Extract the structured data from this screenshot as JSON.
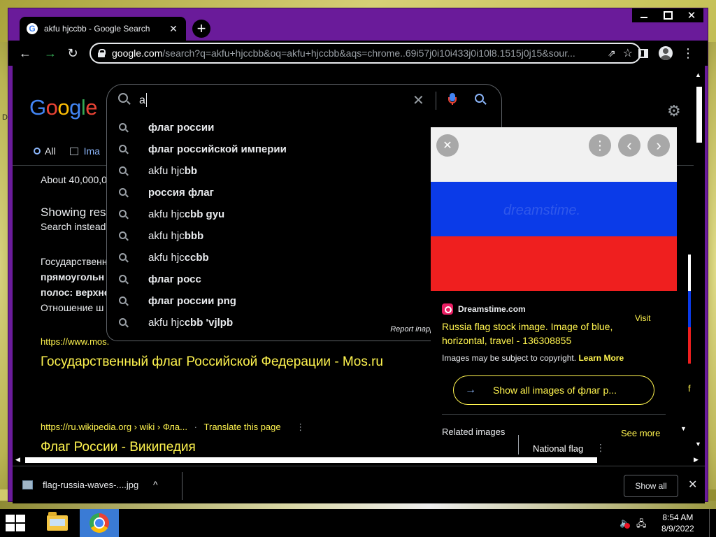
{
  "window": {
    "controls": {
      "minimize": "",
      "maximize": "",
      "close": "✕"
    }
  },
  "tab": {
    "title": "akfu hjccbb - Google Search",
    "close": "✕",
    "favicon": "G"
  },
  "new_tab": "+",
  "toolbar": {
    "back": "←",
    "forward": "→",
    "reload": "↻",
    "url_host": "google.com",
    "url_path": "/search?q=akfu+hjccbb&oq=akfu+hjccbb&aqs=chrome..69i57j0i10i433j0i10l8.1515j0j15&sour...",
    "share": "⇗",
    "star": "☆",
    "menu": "⋮",
    "forward_color": "#34a853"
  },
  "search": {
    "value": "a",
    "clear": "✕"
  },
  "logo": {
    "letters": [
      "G",
      "o",
      "o",
      "g",
      "l",
      "e"
    ],
    "colors": [
      "#4285f4",
      "#ea4335",
      "#fbbc05",
      "#4285f4",
      "#34a853",
      "#ea4335"
    ]
  },
  "settings_icon": "⚙",
  "suggestions": [
    {
      "plain": "",
      "bold": "флаг россии"
    },
    {
      "plain": "",
      "bold": "флаг российской империи"
    },
    {
      "plain": "akfu hjc",
      "bold": "bb"
    },
    {
      "plain": "",
      "bold": "россия флаг"
    },
    {
      "plain": "akfu hjc",
      "bold": "cbb gyu"
    },
    {
      "plain": "akfu hjc",
      "bold": "bbb"
    },
    {
      "plain": "akfu hjc",
      "bold": "ccbb"
    },
    {
      "plain": "",
      "bold": "флаг росс"
    },
    {
      "plain": "",
      "bold": "флаг россии png"
    },
    {
      "plain": "akfu hjc",
      "bold": "cbb 'vjlpb"
    }
  ],
  "report": "Report inappro",
  "nav": {
    "all": "All",
    "images": "Ima"
  },
  "results": {
    "about": "About 40,000,0",
    "showing": "Showing resu",
    "instead": "Search instead",
    "snippet1": "Государственн",
    "snippet2": "прямоугольн",
    "snippet3": "полос: верхне",
    "snippet4": "Отношение ш",
    "url1": "https://www.mos.",
    "title1": "Государственный флаг Российской Федерации - Mos.ru",
    "url2": "https://ru.wikipedia.org › wiki › Фла...",
    "url2_sep": "·",
    "translate": "Translate this page",
    "menu": "⋮",
    "title2": "Флаг России - Википедия"
  },
  "panel": {
    "close": "✕",
    "more": "⋮",
    "prev": "‹",
    "next": "›",
    "watermark": "dreamstime.",
    "site": "Dreamstime.com",
    "visit": "Visit",
    "title": "Russia flag stock image. Image of blue, horizontal, travel - 136308855",
    "copyright": "Images may be subject to copyright.",
    "learn_more": "Learn More",
    "show_all": "Show all images of флаг р...",
    "arrow": "→",
    "related": "Related images",
    "see_more": "See more",
    "national": "National flag",
    "dots": "⋮",
    "flag_colors": [
      "#f1f1f1",
      "#0b3be8",
      "#ef1f1f"
    ]
  },
  "right_partial": "f",
  "download": {
    "file": "flag-russia-waves-....jpg",
    "chevron": "^",
    "show_all": "Show all",
    "close": "✕"
  },
  "taskbar": {
    "time": "8:54 AM",
    "date": "8/9/2022"
  },
  "desktop_char": "D"
}
